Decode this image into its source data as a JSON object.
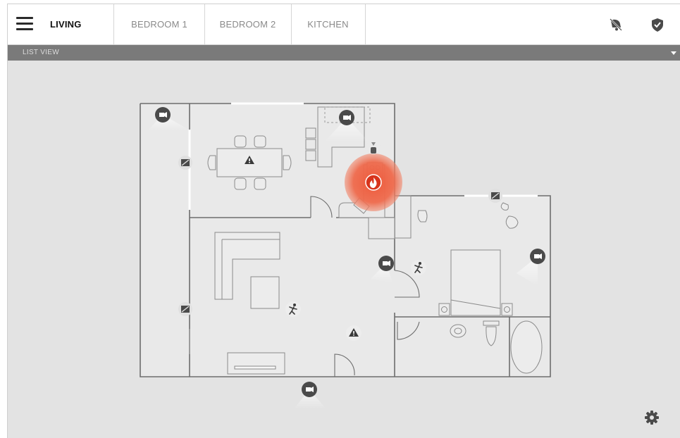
{
  "tabs": [
    {
      "label": "LIVING"
    },
    {
      "label": "BEDROOM 1"
    },
    {
      "label": "BEDROOM 2"
    },
    {
      "label": "KITCHEN"
    }
  ],
  "list_view": {
    "label": "LIST VIEW"
  },
  "icons": {
    "menu": "hamburger-icon",
    "alarm": "bell-slash-icon",
    "shield": "shield-check-icon",
    "dropdown": "caret-down-icon",
    "settings": "gear-icon",
    "camera": "video-camera-icon",
    "window_sensor": "window-sensor-icon",
    "motion": "motion-sensor-icon",
    "warning": "warning-icon",
    "fire": "fire-icon"
  },
  "colors": {
    "accent_alert": "#e8432a",
    "background": "#e3e3e3",
    "sensor_badge": "#4a4a4a"
  }
}
